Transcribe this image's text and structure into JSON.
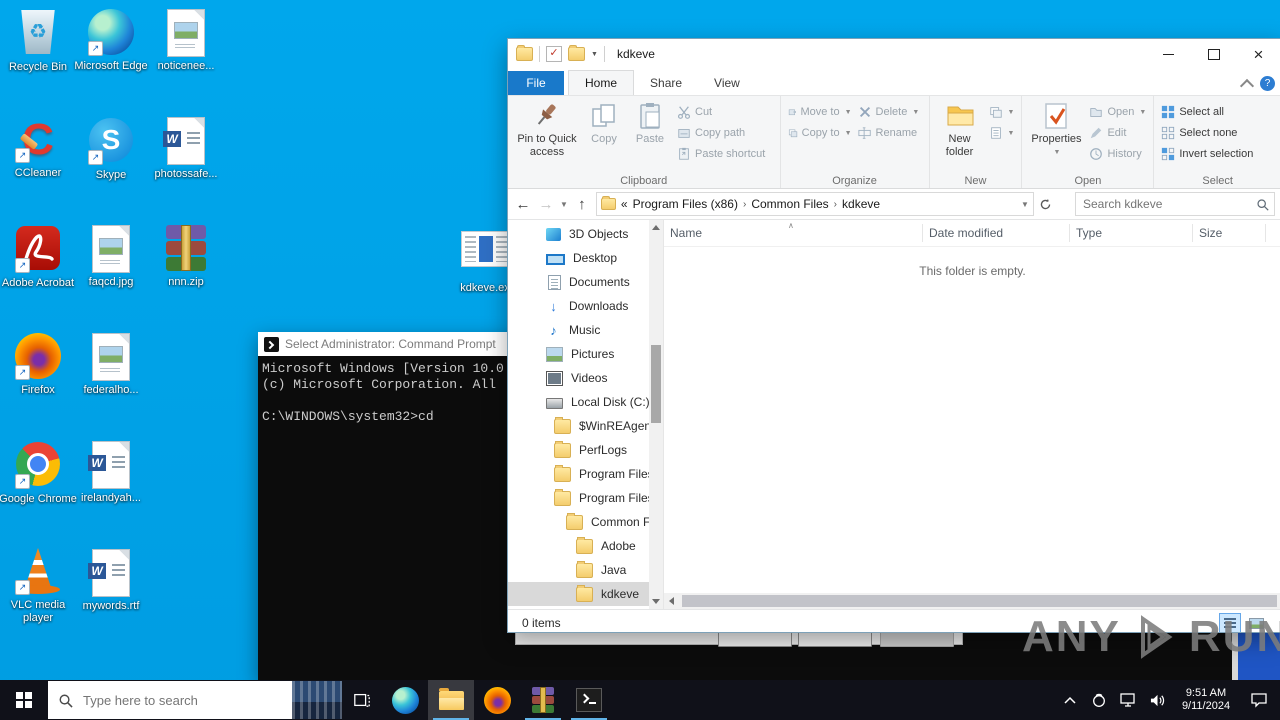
{
  "colors": {
    "desktop_bg": "#00a3e8",
    "file_tab_blue": "#1979ca",
    "taskbar_bg": "#101119",
    "selection_grey": "#d9d9d9",
    "taskbar_underline": "#61b4e8"
  },
  "desktop": {
    "icons": [
      {
        "label": "Recycle Bin",
        "icon": "recycle-bin-icon"
      },
      {
        "label": "Microsoft Edge",
        "icon": "edge-icon"
      },
      {
        "label": "noticenee...",
        "icon": "image-doc-icon"
      },
      {
        "label": "CCleaner",
        "icon": "ccleaner-icon"
      },
      {
        "label": "Skype",
        "icon": "skype-icon"
      },
      {
        "label": "photossafe...",
        "icon": "word-doc-icon"
      },
      {
        "label": "Adobe Acrobat",
        "icon": "acrobat-icon"
      },
      {
        "label": "faqcd.jpg",
        "icon": "image-doc-icon"
      },
      {
        "label": "nnn.zip",
        "icon": "winrar-icon"
      },
      {
        "label": "Firefox",
        "icon": "firefox-icon"
      },
      {
        "label": "federalho...",
        "icon": "image-doc-icon"
      },
      {
        "label": "Google Chrome",
        "icon": "chrome-icon"
      },
      {
        "label": "irelandyah...",
        "icon": "word-doc-icon"
      },
      {
        "label": "VLC media player",
        "icon": "vlc-icon"
      },
      {
        "label": "mywords.rtf",
        "icon": "word-doc-icon"
      },
      {
        "label": "kdkeve.ex",
        "icon": "exe-doc-icon"
      }
    ]
  },
  "explorer": {
    "title": "kdkeve",
    "tabs": {
      "file": "File",
      "home": "Home",
      "share": "Share",
      "view": "View"
    },
    "ribbon": {
      "pin": "Pin to Quick access",
      "copy": "Copy",
      "paste": "Paste",
      "cut": "Cut",
      "copy_path": "Copy path",
      "paste_shortcut": "Paste shortcut",
      "move_to": "Move to",
      "copy_to": "Copy to",
      "delete": "Delete",
      "rename": "Rename",
      "new_folder_line1": "New",
      "new_folder_line2": "folder",
      "properties": "Properties",
      "open": "Open",
      "edit": "Edit",
      "history": "History",
      "select_all": "Select all",
      "select_none": "Select none",
      "invert_selection": "Invert selection",
      "groups": {
        "clipboard": "Clipboard",
        "organize": "Organize",
        "new": "New",
        "open": "Open",
        "select": "Select"
      }
    },
    "address": {
      "prefix": "«",
      "crumbs": [
        "Program Files (x86)",
        "Common Files",
        "kdkeve"
      ],
      "search_placeholder": "Search kdkeve"
    },
    "nav": {
      "items": [
        {
          "label": "3D Objects"
        },
        {
          "label": "Desktop"
        },
        {
          "label": "Documents"
        },
        {
          "label": "Downloads"
        },
        {
          "label": "Music"
        },
        {
          "label": "Pictures"
        },
        {
          "label": "Videos"
        },
        {
          "label": "Local Disk (C:)"
        },
        {
          "label": "$WinREAgent"
        },
        {
          "label": "PerfLogs"
        },
        {
          "label": "Program Files"
        },
        {
          "label": "Program Files"
        },
        {
          "label": "Common Fi"
        },
        {
          "label": "Adobe"
        },
        {
          "label": "Java"
        },
        {
          "label": "kdkeve"
        }
      ]
    },
    "columns": {
      "name": "Name",
      "date_modified": "Date modified",
      "type": "Type",
      "size": "Size"
    },
    "empty_message": "This folder is empty.",
    "status_items": "0 items"
  },
  "cmd": {
    "title": "Select Administrator: Command Prompt",
    "lines": [
      "Microsoft Windows [Version 10.0",
      "(c) Microsoft Corporation. All",
      "",
      "C:\\WINDOWS\\system32>cd"
    ]
  },
  "taskbar": {
    "search_placeholder": "Type here to search",
    "tray": {
      "time": "9:51 AM",
      "date": "9/11/2024"
    }
  },
  "watermark": {
    "left": "ANY",
    "right": "RUN"
  }
}
